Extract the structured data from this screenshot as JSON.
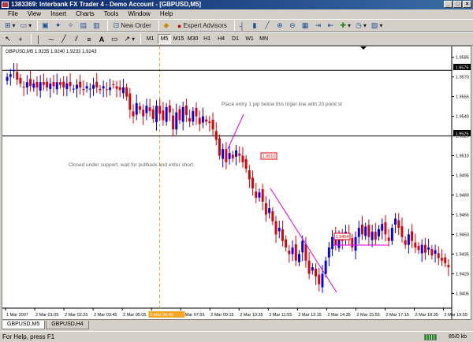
{
  "window": {
    "title": "1383369: Interbank FX Trader 4 - Demo Account - [GBPUSD,M5]",
    "minimize": "_",
    "maximize": "□",
    "close": "×"
  },
  "menu": [
    "File",
    "View",
    "Insert",
    "Charts",
    "Tools",
    "Window",
    "Help"
  ],
  "toolbar": {
    "new_order": "New Order",
    "expert_advisors": "Expert Advisors",
    "timeframes": [
      "M1",
      "M5",
      "M15",
      "M30",
      "H1",
      "H4",
      "D1",
      "W1",
      "MN"
    ],
    "active_timeframe": "M5"
  },
  "chart": {
    "info": "GBPUSD,M5  1.9235 1.9240 1.9233 1.9243",
    "annotation_top": "Place entry 1 pip below this triger line with 20 point st",
    "annotation_left": "Closed under support, wait for pullback and enter short.",
    "box_label_1": "1.9510",
    "box_label_2": "1.9454",
    "price_tag_upper": "1.9575",
    "price_tag_lower": "1.9525",
    "bull_color": "#0000ff",
    "bear_color": "#e00000",
    "vline_color": "#f5a623",
    "trend_color": "#e000e0",
    "hline_color": "#000000"
  },
  "chart_data": {
    "type": "candlestick",
    "symbol": "GBPUSD",
    "timeframe": "M5",
    "y_ticks": [
      "1.9585",
      "1.9570",
      "1.9555",
      "1.9540",
      "1.9525",
      "1.9510",
      "1.9495",
      "1.9480",
      "1.9465",
      "1.9450",
      "1.9435",
      "1.9420",
      "1.9405"
    ],
    "ylim": [
      1.9395,
      1.9592
    ],
    "x_ticks": [
      "1 Mar 2007",
      "2 Mar 01:05",
      "2 Mar 02:25",
      "2 Mar 03:45",
      "2 Mar 05:05",
      "2 Mar 06:25",
      "2 Mar 07:55",
      "2 Mar 09:15",
      "2 Mar 10:35",
      "2 Mar 11:55",
      "2 Mar 13:15",
      "2 Mar 14:35",
      "2 Mar 15:55",
      "2 Mar 17:15",
      "2 Mar 18:35",
      "2 Mar 19:55"
    ],
    "highlighted_x_tick": "2 Mar 06:40",
    "horizontal_lines": [
      1.9575,
      1.9525
    ],
    "closes": [
      1.957,
      1.9572,
      1.9575,
      1.9568,
      1.9565,
      1.9562,
      1.9566,
      1.9563,
      1.9565,
      1.9562,
      1.9566,
      1.9564,
      1.9562,
      1.9565,
      1.9563,
      1.9566,
      1.9564,
      1.9562,
      1.9565,
      1.9563,
      1.9561,
      1.9564,
      1.9562,
      1.956,
      1.9563,
      1.9561,
      1.9564,
      1.9562,
      1.956,
      1.9563,
      1.956,
      1.9562,
      1.9564,
      1.9561,
      1.956,
      1.9562,
      1.9555,
      1.9545,
      1.954,
      1.955,
      1.9545,
      1.954,
      1.9548,
      1.9544,
      1.9538,
      1.9548,
      1.9542,
      1.9537,
      1.9547,
      1.9543,
      1.953,
      1.9543,
      1.9537,
      1.9547,
      1.9541,
      1.9536,
      1.9544,
      1.954,
      1.9534,
      1.954,
      1.9536,
      1.9535,
      1.953,
      1.9522,
      1.951,
      1.9515,
      1.9505,
      1.9512,
      1.9508,
      1.9514,
      1.951,
      1.9505,
      1.95,
      1.9492,
      1.9485,
      1.9478,
      1.9482,
      1.9475,
      1.9465,
      1.947,
      1.946,
      1.945,
      1.9455,
      1.9445,
      1.944,
      1.9435,
      1.944,
      1.943,
      1.9435,
      1.9445,
      1.943,
      1.942,
      1.9425,
      1.9418,
      1.9412,
      1.942,
      1.943,
      1.944,
      1.9448,
      1.9442,
      1.945,
      1.9445,
      1.9452,
      1.9446,
      1.944,
      1.9448,
      1.9455,
      1.945,
      1.9456,
      1.9448,
      1.9452,
      1.9446,
      1.9454,
      1.9458,
      1.945,
      1.9445,
      1.9455,
      1.9462,
      1.9455,
      1.9448,
      1.9442,
      1.945,
      1.9445,
      1.944,
      1.9438,
      1.9442,
      1.9436,
      1.944,
      1.9434,
      1.9438,
      1.9432,
      1.943,
      1.9428,
      1.9425
    ]
  },
  "tabs": [
    "GBPUSD,M5",
    "GBPUSD,H4"
  ],
  "status": {
    "help": "For Help, press F1",
    "traffic": "85/0 kb"
  }
}
